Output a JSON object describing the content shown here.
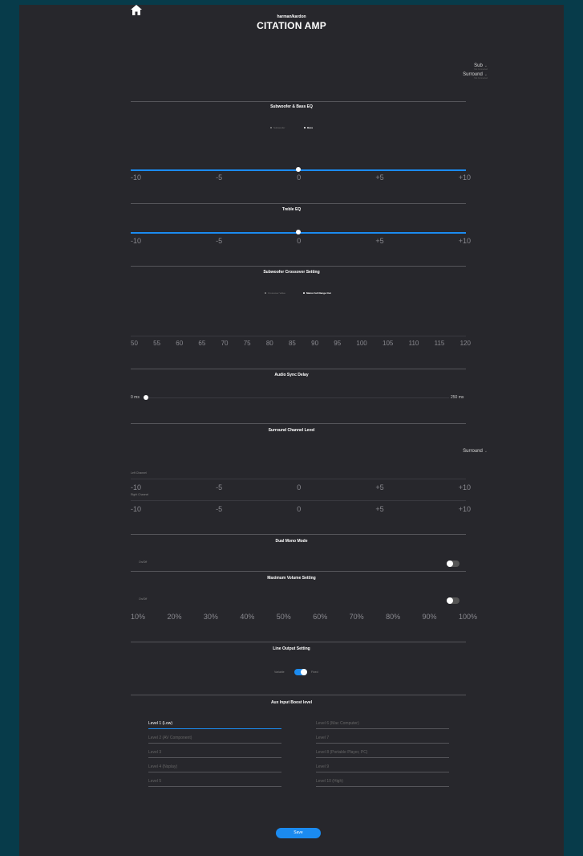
{
  "header": {
    "brand_small": "harman/kardon",
    "brand_title": "CITATION AMP"
  },
  "selectors": {
    "sub": {
      "label": "Sub",
      "sub_label": "Not Connected"
    },
    "surround": {
      "label": "Surround",
      "sub_label": "Not Connected"
    }
  },
  "bass_eq": {
    "title": "Subwoofer & Bass EQ",
    "segments": [
      "Subwoofer",
      "Bass"
    ],
    "active_segment": "Bass",
    "value": 0,
    "scale": [
      "-10",
      "-5",
      "0",
      "+5",
      "+10"
    ]
  },
  "treble_eq": {
    "title": "Treble EQ",
    "value": 0,
    "scale": [
      "-10",
      "-5",
      "0",
      "+5",
      "+10"
    ]
  },
  "crossover": {
    "title": "Subwoofer Crossover Setting",
    "segments": [
      "Crossover Value",
      "Mains Full Range Out"
    ],
    "active_segment": "Mains Full Range Out",
    "scale": [
      "50",
      "55",
      "60",
      "65",
      "70",
      "75",
      "80",
      "85",
      "90",
      "95",
      "100",
      "105",
      "110",
      "115",
      "120"
    ]
  },
  "audio_sync": {
    "title": "Audio Sync Delay",
    "min_label": "0 ms",
    "max_label": "250 ms",
    "value_ms": 0
  },
  "surround_level": {
    "title": "Surround Channel Level",
    "selector_label": "Surround",
    "left_label": "Left Channel",
    "right_label": "Right Channel",
    "scale": [
      "-10",
      "-5",
      "0",
      "+5",
      "+10"
    ]
  },
  "dual_mono": {
    "title": "Dual Mono Mode",
    "toggle_label": "On/Off",
    "enabled": false
  },
  "max_volume": {
    "title": "Maximum Volume Setting",
    "toggle_label": "On/Off",
    "enabled": false,
    "scale": [
      "10%",
      "20%",
      "30%",
      "40%",
      "50%",
      "60%",
      "70%",
      "80%",
      "90%",
      "100%"
    ]
  },
  "line_output": {
    "title": "Line Output Setting",
    "left_label": "Variable",
    "right_label": "Fixed",
    "fixed_enabled": true
  },
  "aux_boost": {
    "title": "Aux Input Boost level",
    "selected": "Level 1 (Low)",
    "levels_left": [
      "Level 1 (Low)",
      "Level 2 (AV Component)",
      "Level 3",
      "Level 4 (Nsplay)",
      "Level 5"
    ],
    "levels_right": [
      "Level 6 (Mac Computer)",
      "Level 7",
      "Level 8 (Portable Player, PC)",
      "Level 9",
      "Level 10 (High)"
    ]
  },
  "actions": {
    "save_label": "Save"
  },
  "colors": {
    "background": "#27272c",
    "outer": "#073b4a",
    "accent": "#1b8bf0"
  }
}
